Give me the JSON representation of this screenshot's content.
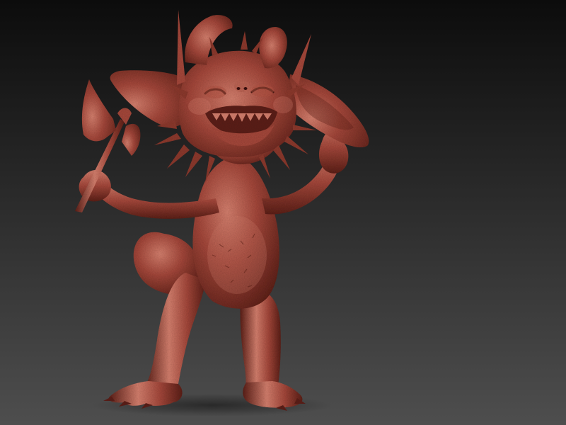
{
  "scene": {
    "colors": {
      "background_top": "#0c0c0c",
      "background_bottom": "#4e4e4e",
      "clay_base": "#a8493c",
      "clay_light": "#d98270",
      "clay_dark": "#5e2018",
      "clay_shadow": "#3c120c"
    },
    "subject": "sculpted-creature",
    "material": "red-clay-matcap",
    "props": [
      "axe"
    ]
  }
}
